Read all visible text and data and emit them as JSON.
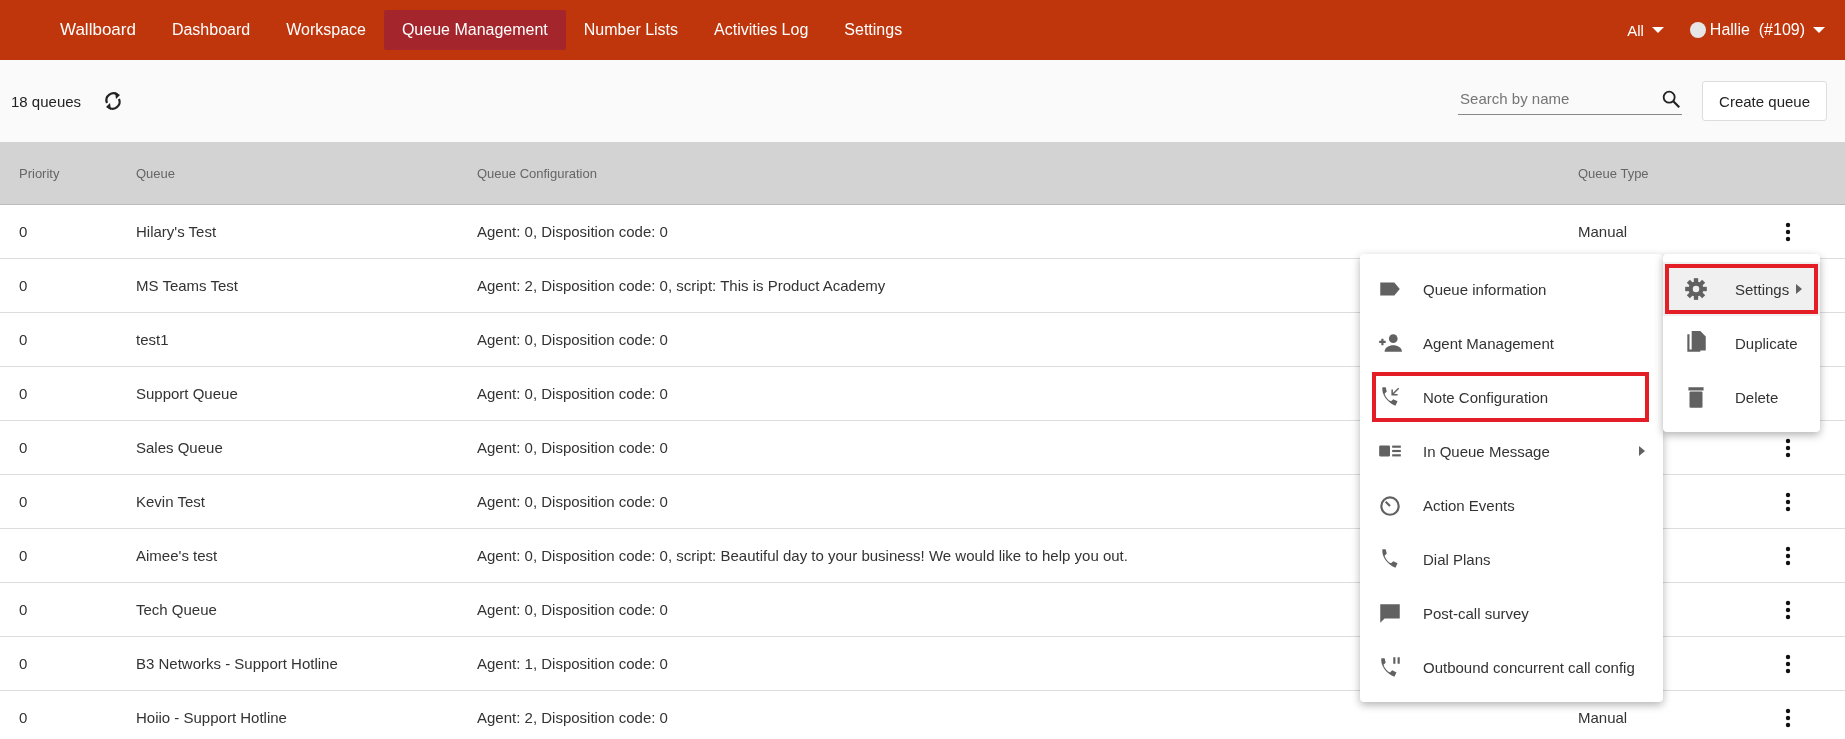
{
  "nav": {
    "brand": "Wallboard",
    "items": [
      {
        "label": "Dashboard",
        "selected": false
      },
      {
        "label": "Workspace",
        "selected": false
      },
      {
        "label": "Queue Management",
        "selected": true
      },
      {
        "label": "Number Lists",
        "selected": false
      },
      {
        "label": "Activities Log",
        "selected": false
      },
      {
        "label": "Settings",
        "selected": false
      }
    ],
    "filter": "All",
    "user": "Hallie  (#109)"
  },
  "toolbar": {
    "count": "18 queues",
    "search": {
      "placeholder": "Search by name"
    },
    "create_button": "Create queue"
  },
  "table": {
    "columns": [
      "Priority",
      "Queue",
      "Queue Configuration",
      "Queue Type"
    ],
    "rows": [
      {
        "priority": "0",
        "queue": "Hilary's Test",
        "config": "Agent: 0, Disposition code: 0",
        "queue_type": "Manual",
        "menu_button": true
      },
      {
        "priority": "0",
        "queue": "MS Teams Test",
        "config": "Agent: 2, Disposition code: 0, script: This is Product Academy"
      },
      {
        "priority": "0",
        "queue": "test1",
        "config": "Agent: 0, Disposition code: 0"
      },
      {
        "priority": "0",
        "queue": "Support Queue",
        "config": "Agent: 0, Disposition code: 0"
      },
      {
        "priority": "0",
        "queue": "Sales Queue",
        "config": "Agent: 0, Disposition code: 0",
        "menu_button": true
      },
      {
        "priority": "0",
        "queue": "Kevin Test",
        "config": "Agent: 0, Disposition code: 0",
        "menu_button": true
      },
      {
        "priority": "0",
        "queue": "Aimee's test",
        "config": "Agent: 0, Disposition code: 0, script: Beautiful day to your business! We would like to help you out.",
        "menu_button": true
      },
      {
        "priority": "0",
        "queue": "Tech Queue",
        "config": "Agent: 0, Disposition code: 0",
        "menu_button": true
      },
      {
        "priority": "0",
        "queue": "B3 Networks - Support Hotline",
        "config": "Agent: 1, Disposition code: 0",
        "menu_button": true
      },
      {
        "priority": "0",
        "queue": "Hoiio - Support Hotline",
        "config": "Agent: 2, Disposition code: 0",
        "queue_type": "Manual",
        "menu_button": true
      }
    ]
  },
  "settings_menu": {
    "items": [
      {
        "kind": "label",
        "label": "Queue information",
        "has_submenu": false,
        "highlighted": false
      },
      {
        "kind": "person-add",
        "label": "Agent Management",
        "has_submenu": false,
        "highlighted": false
      },
      {
        "kind": "phone-in",
        "label": "Note Configuration",
        "has_submenu": false,
        "highlighted": true
      },
      {
        "kind": "card-list",
        "label": "In Queue Message",
        "has_submenu": true,
        "highlighted": false
      },
      {
        "kind": "timer",
        "label": "Action Events",
        "has_submenu": false,
        "highlighted": false
      },
      {
        "kind": "phone",
        "label": "Dial Plans",
        "has_submenu": false,
        "highlighted": false
      },
      {
        "kind": "chat",
        "label": "Post-call survey",
        "has_submenu": false,
        "highlighted": false
      },
      {
        "kind": "phone-pause",
        "label": "Outbound concurrent call config",
        "has_submenu": false,
        "highlighted": false
      }
    ]
  },
  "row_menu": {
    "items": [
      {
        "kind": "gear",
        "label": "Settings",
        "has_submenu": true,
        "selected": true,
        "highlighted": true
      },
      {
        "kind": "copy",
        "label": "Duplicate",
        "has_submenu": false,
        "selected": false,
        "highlighted": false
      },
      {
        "kind": "trash",
        "label": "Delete",
        "has_submenu": false,
        "selected": false,
        "highlighted": false
      }
    ]
  }
}
